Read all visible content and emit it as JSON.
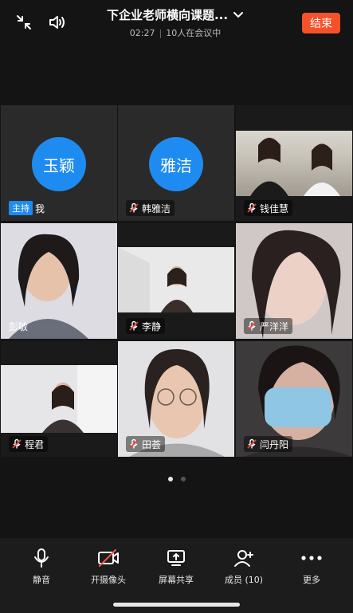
{
  "header": {
    "title": "下企业老师横向课题...",
    "time": "02:27",
    "attendance": "10人在会议中",
    "end_label": "结束"
  },
  "participants": [
    {
      "name": "玉颖",
      "avatar_text": "玉颖",
      "host_tag": "主持",
      "self_label": "我"
    },
    {
      "name": "韩雅洁",
      "avatar_text": "雅洁"
    },
    {
      "name": "钱佳慧"
    },
    {
      "name": "彭敏"
    },
    {
      "name": "李静"
    },
    {
      "name": "严洋洋"
    },
    {
      "name": "程君"
    },
    {
      "name": "田荟"
    },
    {
      "name": "闫丹阳"
    }
  ],
  "toolbar": {
    "mute_label": "静音",
    "camera_label": "开摄像头",
    "share_label": "屏幕共享",
    "members_label": "成员 (10)",
    "more_label": "更多"
  },
  "colors": {
    "accent_blue": "#1e8bf0",
    "end_red": "#f5512a",
    "mic_off_red": "#e0463a"
  }
}
